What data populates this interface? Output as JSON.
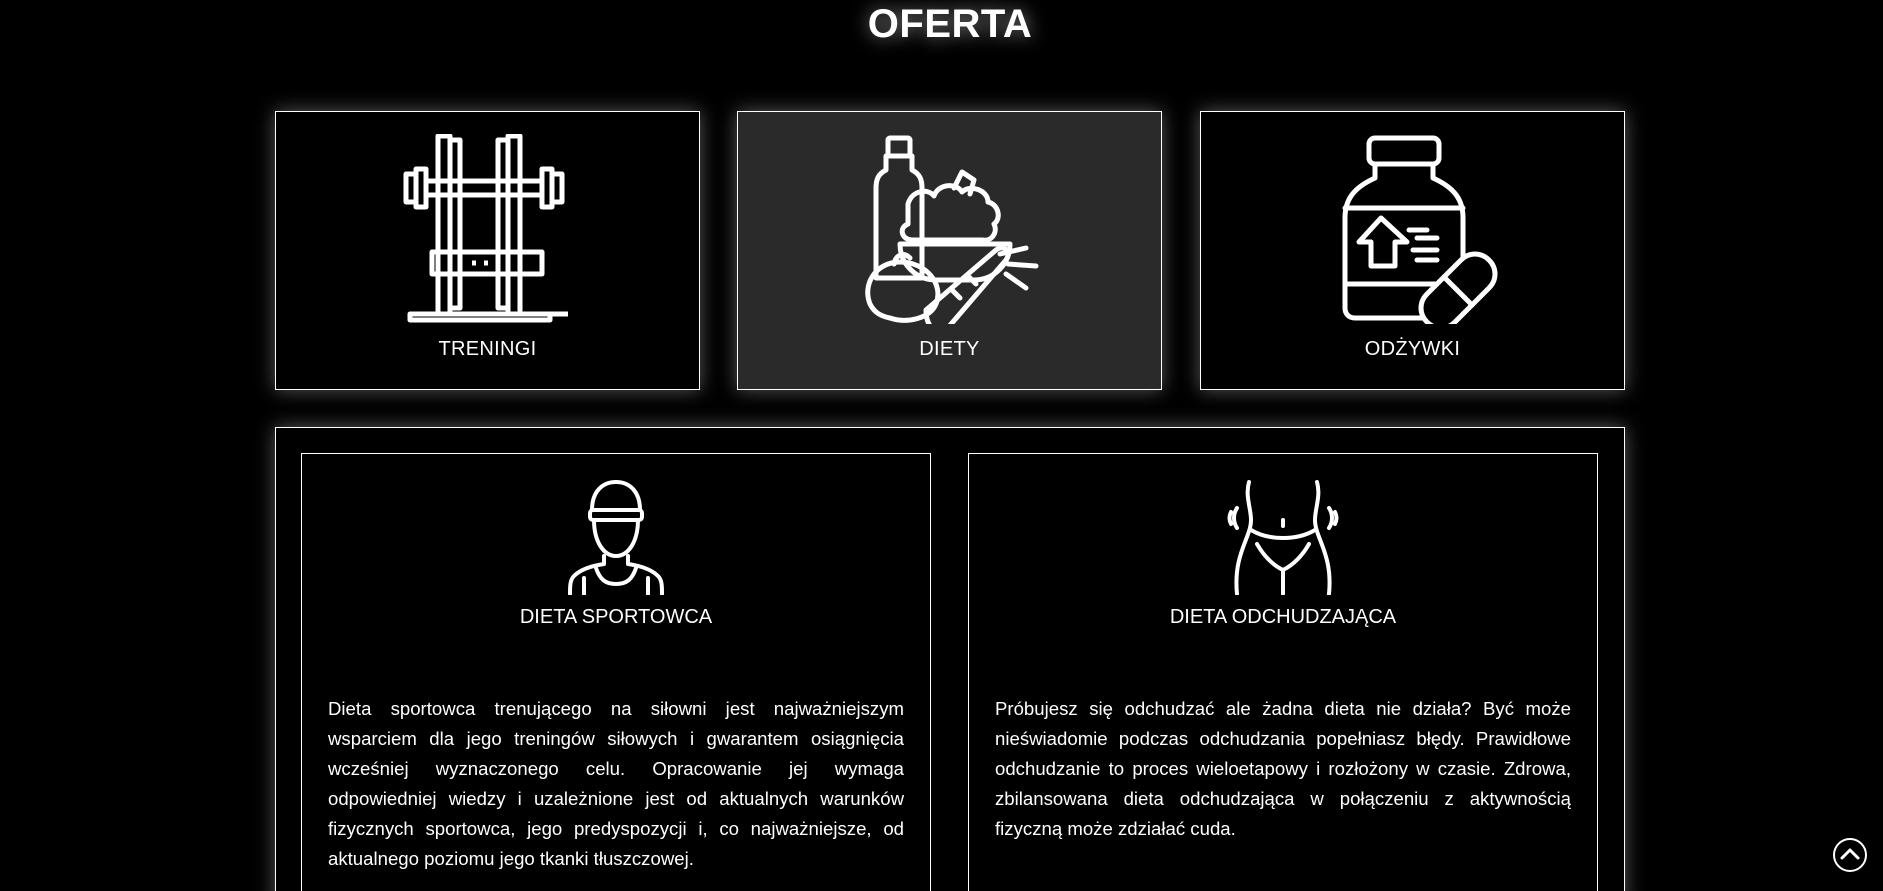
{
  "section": {
    "title": "OFERTA"
  },
  "offer_cards": [
    {
      "label": "TRENINGI",
      "icon": "gym-rack-icon",
      "active": false
    },
    {
      "label": "DIETY",
      "icon": "healthy-food-icon",
      "active": true
    },
    {
      "label": "ODŻYWKI",
      "icon": "supplement-jar-icon",
      "active": false
    }
  ],
  "diet_panels": [
    {
      "icon": "athlete-icon",
      "title": "DIETA SPORTOWCA",
      "text": "Dieta sportowca trenującego na siłowni jest najważniejszym wsparciem dla jego treningów siłowych i gwarantem osiągnięcia wcześniej wyznaczonego celu. Opracowanie jej wymaga odpowiedniej wiedzy i uzależnione jest od aktualnych warunków fizycznych sportowca, jego predyspozycji i, co najważniejsze, od aktualnego poziomu jego tkanki tłuszczowej."
    },
    {
      "icon": "slim-waist-icon",
      "title": "DIETA ODCHUDZAJĄCA",
      "text": "Próbujesz się odchudzać ale żadna dieta nie działa? Być może nieświadomie podczas odchudzania popełniasz błędy. Prawidłowe odchudzanie to proces wieloetapowy i rozłożony w czasie. Zdrowa, zbilansowana dieta odchudzająca w połączeniu z aktywnością fizyczną może zdziałać cuda."
    }
  ],
  "controls": {
    "scroll_top_icon": "chevron-up-circle-icon"
  },
  "colors": {
    "background": "#000000",
    "foreground": "#ffffff",
    "active_card": "#2a2a2a"
  }
}
